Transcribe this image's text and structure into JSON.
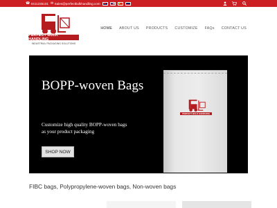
{
  "topbar": {
    "phone": "0411235101",
    "email": "Sales@perfectbulkhandling.com",
    "flags": [
      "au-flag",
      "us-flag",
      "cn-flag",
      "gb-flag"
    ],
    "icons": [
      "user-icon",
      "cart-icon",
      "search-icon"
    ],
    "background_color": "#cc1f24"
  },
  "header": {
    "logo_text": "PERFECT BULK HANDLING",
    "tagline": "INDUSTRIAL PACKAGING SOLUTIONS",
    "nav": [
      {
        "label": "HOME",
        "active": true
      },
      {
        "label": "ABOUT US",
        "active": false
      },
      {
        "label": "PRODUCTS",
        "active": false
      },
      {
        "label": "CUSTOMIZE",
        "active": false
      },
      {
        "label": "FAQs",
        "active": false
      },
      {
        "label": "CONTACT US",
        "active": false
      }
    ]
  },
  "hero": {
    "title": "BOPP-woven Bags",
    "description": "Customize high quality BOPP-woven bags as your product packaging",
    "button_label": "SHOP NOW",
    "bag_logo_text": "PERFECT BULK HANDLING",
    "brand_color": "#b51c20"
  },
  "subline": "FIBC bags, Polypropylene-woven bags, Non-woven bags"
}
